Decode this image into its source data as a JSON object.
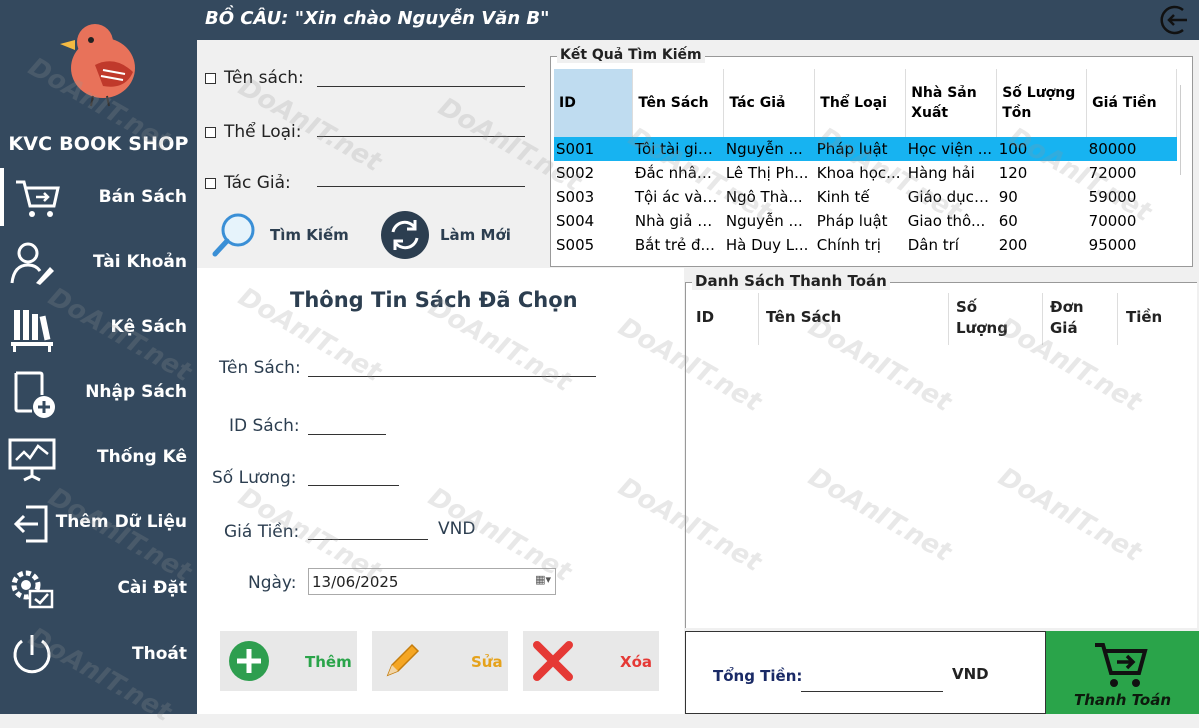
{
  "app": {
    "shop_name": "KVC BOOK SHOP",
    "greeting": "BỒ CÂU: \"Xin chào Nguyễn Văn B\""
  },
  "sidebar": {
    "items": [
      {
        "label": "Bán Sách",
        "icon": "cart-icon"
      },
      {
        "label": "Tài Khoản",
        "icon": "user-edit-icon"
      },
      {
        "label": "Kệ Sách",
        "icon": "bookshelf-icon"
      },
      {
        "label": "Nhập Sách",
        "icon": "book-add-icon"
      },
      {
        "label": "Thống Kê",
        "icon": "chart-icon"
      },
      {
        "label": "Thêm Dữ Liệu",
        "icon": "import-icon"
      },
      {
        "label": "Cài Đặt",
        "icon": "settings-icon"
      },
      {
        "label": "Thoát",
        "icon": "power-icon"
      }
    ]
  },
  "search": {
    "book_name_label": "Tên sách:",
    "category_label": "Thể Loại:",
    "author_label": "Tác Giả:",
    "search_button": "Tìm Kiếm",
    "refresh_button": "Làm Mới"
  },
  "results": {
    "title": "Kết Quả Tìm Kiếm",
    "columns": [
      "ID",
      "Tên Sách",
      "Tác Giả",
      "Thể Loại",
      "Nhà Sản Xuất",
      "Số Lượng Tồn",
      "Giá Tiền"
    ],
    "rows": [
      [
        "S001",
        "Tôi tài giỏi...",
        "Nguyễn ...",
        "Pháp luật",
        "Học viện ...",
        "100",
        "80000"
      ],
      [
        "S002",
        "Đắc nhân...",
        "Lê Thị Ph...",
        "Khoa học...",
        "Hàng hải",
        "120",
        "72000"
      ],
      [
        "S003",
        "Tội ác và ...",
        "Ngô Thà...",
        "Kinh tế",
        "Giáo dục ...",
        "90",
        "59000"
      ],
      [
        "S004",
        "Nhà giả k...",
        "Nguyễn ...",
        "Pháp luật",
        "Giao thô...",
        "60",
        "70000"
      ],
      [
        "S005",
        "Bắt trẻ đ...",
        "Hà Duy L...",
        "Chính trị",
        "Dân trí",
        "200",
        "95000"
      ]
    ]
  },
  "info": {
    "title": "Thông Tin Sách Đã Chọn",
    "book_name_label": "Tên Sách:",
    "book_id_label": "ID Sách:",
    "quantity_label": "Số Lương:",
    "price_label": "Giá Tiền:",
    "price_unit": "VND",
    "date_label": "Ngày:",
    "date_value": "13/06/2025",
    "add_button": "Thêm",
    "edit_button": "Sửa",
    "delete_button": "Xóa"
  },
  "payment": {
    "title": "Danh Sách Thanh Toán",
    "columns": [
      "ID",
      "Tên Sách",
      "Số Lượng",
      "Đơn Giá",
      "Tiền"
    ],
    "total_label": "Tổng Tiền:",
    "total_unit": "VND",
    "pay_button": "Thanh Toán"
  },
  "watermark": "DoAnIT.net"
}
